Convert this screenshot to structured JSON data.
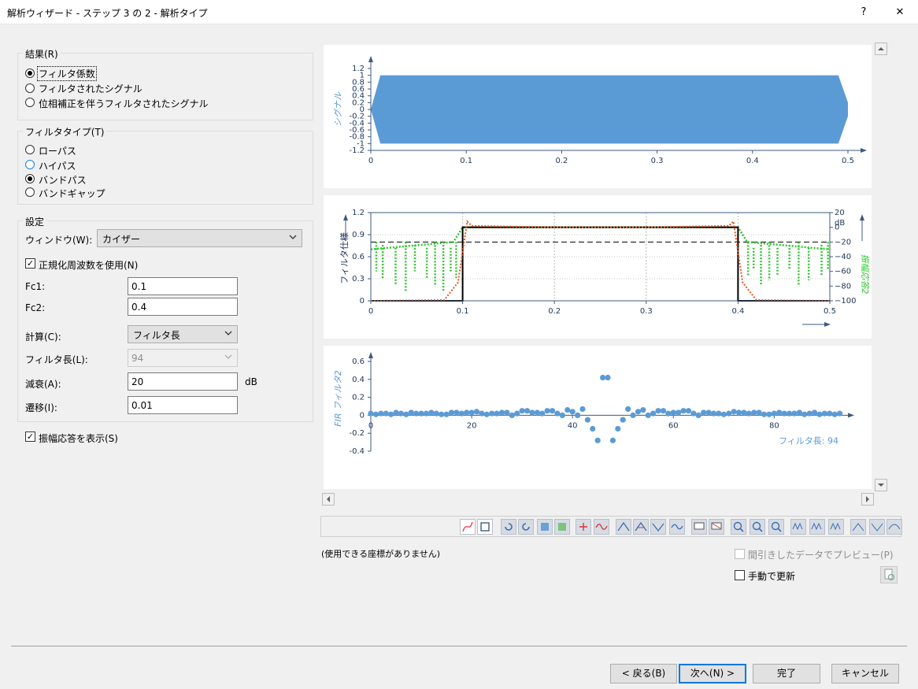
{
  "window": {
    "title": "解析ウィザード - ステップ 3 の 2 - 解析タイプ",
    "help_label": "?",
    "close_label": "✕"
  },
  "result_group": {
    "title": "結果(R)",
    "options": [
      "フィルタ係数",
      "フィルタされたシグナル",
      "位相補正を伴うフィルタされたシグナル"
    ],
    "selected": 0
  },
  "filter_type_group": {
    "title": "フィルタタイプ(T)",
    "options": [
      "ローパス",
      "ハイパス",
      "バンドパス",
      "バンドギャップ"
    ],
    "selected": 2
  },
  "settings_group": {
    "title": "設定",
    "window_label": "ウィンドウ(W):",
    "window_value": "カイザー",
    "normalized_label": "正規化周波数を使用(N)",
    "normalized_checked": true,
    "fc1_label": "Fc1:",
    "fc1_value": "0.1",
    "fc2_label": "Fc2:",
    "fc2_value": "0.4",
    "calc_label": "計算(C):",
    "calc_value": "フィルタ長",
    "length_label": "フィルタ長(L):",
    "length_value": "94",
    "attenuation_label": "減衰(A):",
    "attenuation_value": "20",
    "attenuation_unit": "dB",
    "transition_label": "遷移(I):",
    "transition_value": "0.01"
  },
  "show_response": {
    "label": "振幅応答を表示(S)",
    "checked": true
  },
  "status": {
    "no_coords": "(使用できる座標がありません)"
  },
  "preview": {
    "thinned_label": "間引きしたデータでプレビュー(P)",
    "thinned_checked": false,
    "manual_label": "手動で更新",
    "manual_checked": false
  },
  "buttons": {
    "back": "< 戻る(B)",
    "next": "次へ(N) >",
    "finish": "完了",
    "cancel": "キャンセル"
  },
  "colors": {
    "signal": "#5b9bd5",
    "response": "#e8531f",
    "amplitude": "#2ec62e",
    "spec": "#000000",
    "fir": "#5b9bd5",
    "accent": "#0078d7"
  },
  "chart_data": [
    {
      "type": "area",
      "ylabel": "シグナル",
      "xlim": [
        0,
        0.5
      ],
      "ylim": [
        -1.2,
        1.2
      ],
      "x_ticks": [
        "0",
        "0.1",
        "0.2",
        "0.3",
        "0.4",
        "0.5"
      ],
      "y_ticks": [
        "1.2",
        "1",
        "0.8",
        "0.6",
        "0.4",
        "0.2",
        "0",
        "-0.2",
        "-0.4",
        "-0.6",
        "-0.8",
        "-1",
        "-1.2"
      ],
      "x": [
        0,
        0.01,
        0.1,
        0.2,
        0.3,
        0.4,
        0.49,
        0.5
      ],
      "upper": [
        0,
        1,
        1,
        1,
        1,
        1,
        1,
        0.2
      ],
      "lower": [
        0,
        -1,
        -1,
        -1,
        -1,
        -1,
        -1,
        -0.2
      ]
    },
    {
      "type": "line",
      "ylabel": "フィルタ仕様",
      "y2label": "振幅応答2",
      "y2unit": "dB",
      "xlim": [
        0,
        0.5
      ],
      "ylim": [
        0,
        1.2
      ],
      "y2lim": [
        -100,
        20
      ],
      "x_ticks": [
        "0",
        "0.1",
        "0.2",
        "0.3",
        "0.4",
        "0.5"
      ],
      "y_ticks": [
        "1.2",
        "0.9",
        "0.6",
        "0.3",
        "0"
      ],
      "y2_ticks": [
        "20",
        "0",
        "−20",
        "−40",
        "−60",
        "−80",
        "−100"
      ],
      "series": [
        {
          "x": [
            0,
            0.1,
            0.1,
            0.4,
            0.4,
            0.5
          ],
          "y": [
            0,
            0,
            1,
            1,
            0,
            0
          ]
        },
        {
          "x": [
            0,
            0.08,
            0.095,
            0.105,
            0.11,
            0.2,
            0.3,
            0.39,
            0.395,
            0.405,
            0.42,
            0.5
          ],
          "y": [
            0,
            0.01,
            0.25,
            1.08,
            1.02,
            1.0,
            1.0,
            1.02,
            1.08,
            0.25,
            0.01,
            0
          ]
        },
        {
          "x": [
            0,
            0.09,
            0.1,
            0.2,
            0.3,
            0.4,
            0.41,
            0.5
          ],
          "y": [
            -30,
            -20,
            0,
            0,
            0,
            0,
            -20,
            -30
          ]
        }
      ],
      "reference_line_y": 0.8
    },
    {
      "type": "scatter",
      "ylabel": "FIR フィルタ2",
      "xlim": [
        0,
        94
      ],
      "ylim": [
        -0.4,
        0.6
      ],
      "x_ticks": [
        "0",
        "20",
        "40",
        "60",
        "80"
      ],
      "y_ticks": [
        "0.6",
        "0.4",
        "0.2",
        "0",
        "-0.2",
        "-0.4"
      ],
      "annotation": "フィルタ長: 94",
      "x": [
        0,
        1,
        2,
        3,
        4,
        5,
        6,
        7,
        8,
        9,
        10,
        11,
        12,
        13,
        14,
        15,
        16,
        17,
        18,
        19,
        20,
        21,
        22,
        23,
        24,
        25,
        26,
        27,
        28,
        29,
        30,
        31,
        32,
        33,
        34,
        35,
        36,
        37,
        38,
        39,
        40,
        41,
        42,
        43,
        44,
        45,
        46,
        47,
        48,
        49,
        50,
        51,
        52,
        53,
        54,
        55,
        56,
        57,
        58,
        59,
        60,
        61,
        62,
        63,
        64,
        65,
        66,
        67,
        68,
        69,
        70,
        71,
        72,
        73,
        74,
        75,
        76,
        77,
        78,
        79,
        80,
        81,
        82,
        83,
        84,
        85,
        86,
        87,
        88,
        89,
        90,
        91,
        92,
        93
      ],
      "y": [
        0.02,
        0.01,
        0.02,
        0.02,
        0.01,
        0.03,
        0.02,
        0.01,
        0.03,
        0.02,
        0.02,
        0.02,
        0.03,
        0.02,
        0.01,
        0.01,
        0.03,
        0.03,
        0.02,
        0.03,
        0.03,
        0.04,
        0.02,
        0.01,
        0.02,
        0.02,
        0.03,
        0.03,
        0.0,
        0.02,
        0.05,
        0.05,
        0.03,
        0.03,
        0.02,
        0.05,
        0.05,
        0.02,
        0.0,
        0.06,
        0.04,
        0.0,
        0.07,
        -0.05,
        -0.15,
        -0.28,
        0.42,
        0.42,
        -0.28,
        -0.15,
        -0.05,
        0.07,
        0.0,
        0.04,
        0.06,
        0.0,
        0.02,
        0.05,
        0.05,
        0.02,
        0.03,
        0.03,
        0.05,
        0.05,
        0.02,
        0.0,
        0.03,
        0.03,
        0.02,
        0.02,
        0.01,
        0.02,
        0.04,
        0.03,
        0.03,
        0.02,
        0.03,
        0.03,
        0.01,
        0.01,
        0.02,
        0.03,
        0.02,
        0.02,
        0.02,
        0.03,
        0.01,
        0.02,
        0.03,
        0.01,
        0.02,
        0.02,
        0.01,
        0.02
      ]
    }
  ]
}
